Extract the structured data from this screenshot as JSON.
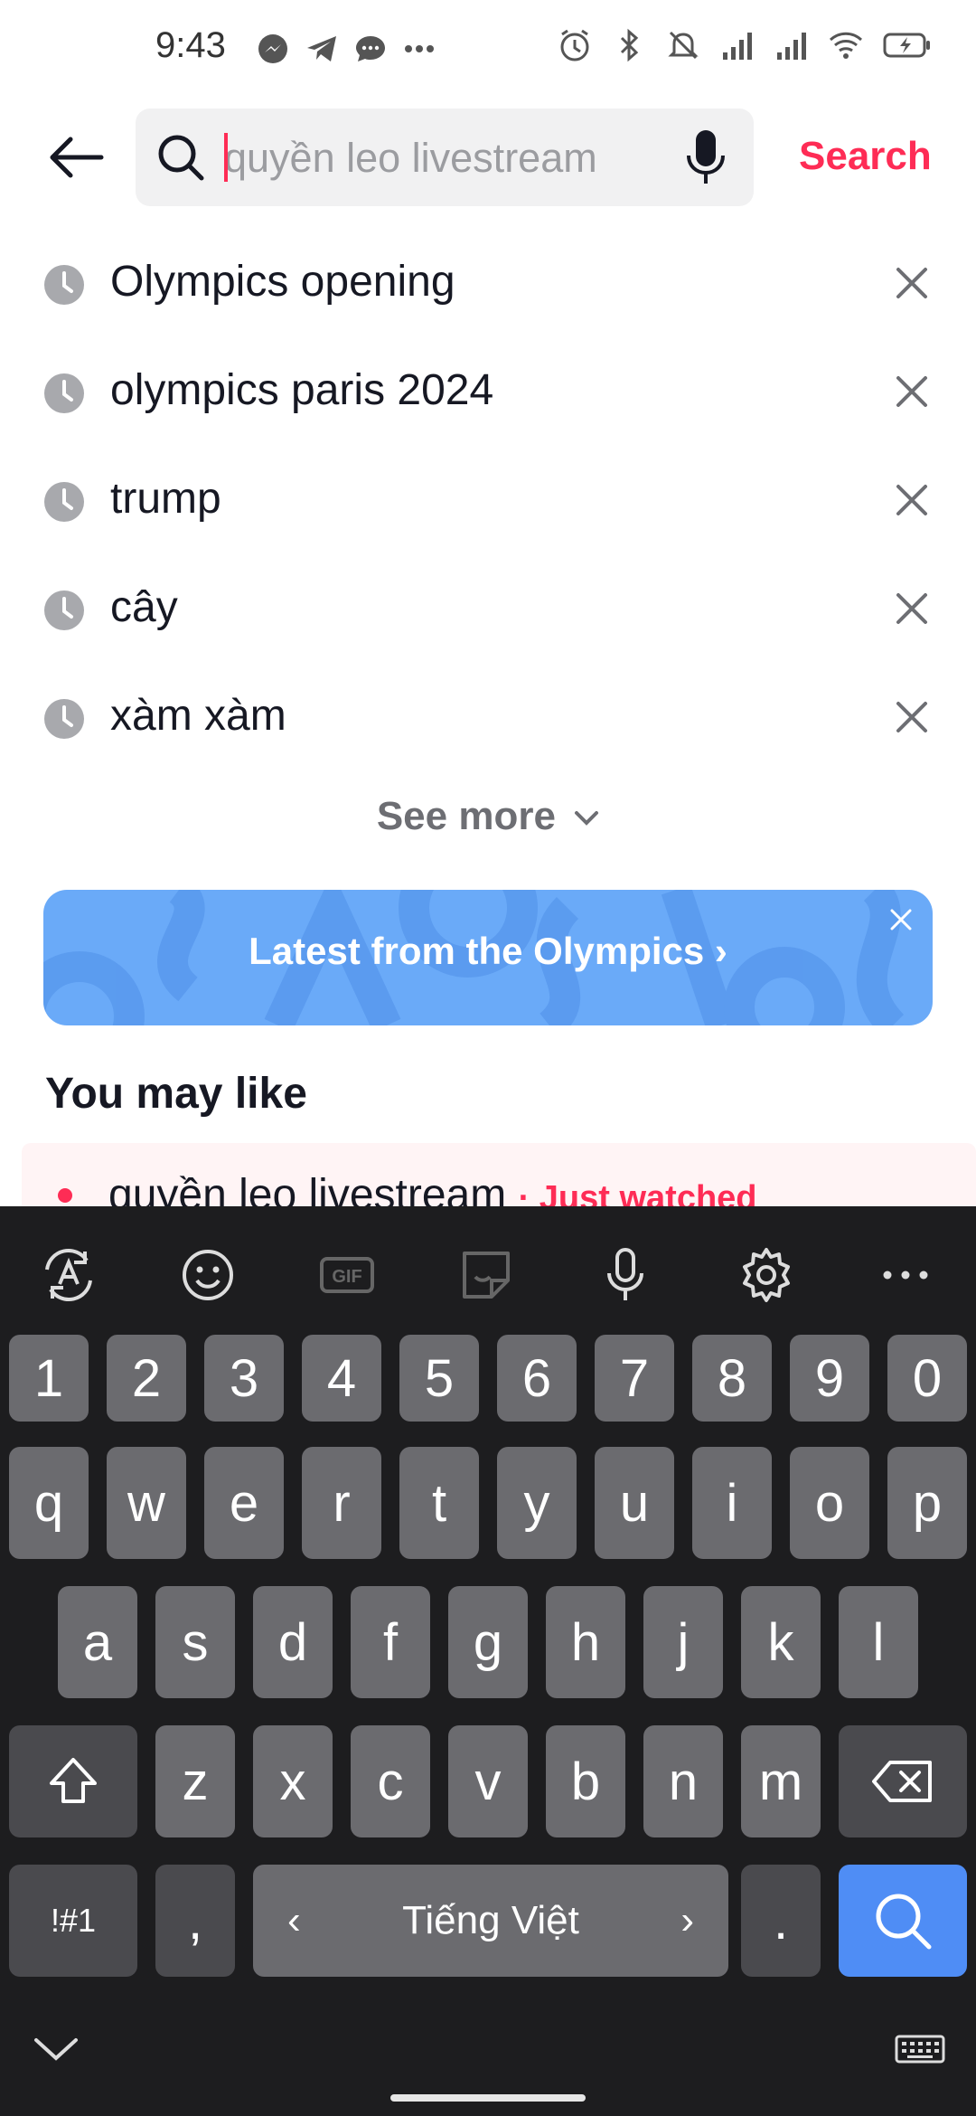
{
  "status_bar": {
    "time": "9:43"
  },
  "search": {
    "placeholder": "quyền leo livestream",
    "value": "",
    "button_label": "Search"
  },
  "history": [
    {
      "text": "Olympics opening"
    },
    {
      "text": "olympics paris 2024"
    },
    {
      "text": "trump"
    },
    {
      "text": "cây"
    },
    {
      "text": "xàm xàm"
    }
  ],
  "see_more_label": "See more",
  "banner": {
    "label": "Latest from the Olympics ›",
    "color": "#6aaaf8"
  },
  "you_may_like": {
    "title": "You may like",
    "items": [
      {
        "text": "quyền leo livestream",
        "badge": "· Just watched"
      }
    ]
  },
  "keyboard": {
    "number_row": [
      "1",
      "2",
      "3",
      "4",
      "5",
      "6",
      "7",
      "8",
      "9",
      "0"
    ],
    "row1": [
      "q",
      "w",
      "e",
      "r",
      "t",
      "y",
      "u",
      "i",
      "o",
      "p"
    ],
    "row2": [
      "a",
      "s",
      "d",
      "f",
      "g",
      "h",
      "j",
      "k",
      "l"
    ],
    "row3": [
      "z",
      "x",
      "c",
      "v",
      "b",
      "n",
      "m"
    ],
    "symbols_label": "!#1",
    "comma_label": ",",
    "language_label": "Tiếng Việt",
    "lang_prev": "‹",
    "lang_next": "›",
    "period_label": ".",
    "toolbar_icons": [
      "text-edit-icon",
      "emoji-icon",
      "gif-icon",
      "sticker-icon",
      "mic-icon",
      "settings-icon",
      "more-icon"
    ]
  },
  "colors": {
    "accent": "#fe2c55",
    "keyboard_bg": "#1d1d1f",
    "key_bg": "#6b6b6f",
    "enter_key": "#4f8df5"
  }
}
